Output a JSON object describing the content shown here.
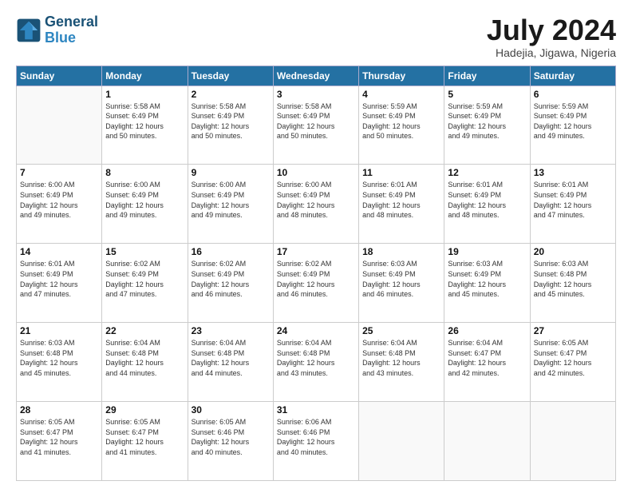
{
  "header": {
    "logo_line1": "General",
    "logo_line2": "Blue",
    "month": "July 2024",
    "location": "Hadejia, Jigawa, Nigeria"
  },
  "days_of_week": [
    "Sunday",
    "Monday",
    "Tuesday",
    "Wednesday",
    "Thursday",
    "Friday",
    "Saturday"
  ],
  "weeks": [
    [
      {
        "day": "",
        "info": ""
      },
      {
        "day": "1",
        "info": "Sunrise: 5:58 AM\nSunset: 6:49 PM\nDaylight: 12 hours\nand 50 minutes."
      },
      {
        "day": "2",
        "info": "Sunrise: 5:58 AM\nSunset: 6:49 PM\nDaylight: 12 hours\nand 50 minutes."
      },
      {
        "day": "3",
        "info": "Sunrise: 5:58 AM\nSunset: 6:49 PM\nDaylight: 12 hours\nand 50 minutes."
      },
      {
        "day": "4",
        "info": "Sunrise: 5:59 AM\nSunset: 6:49 PM\nDaylight: 12 hours\nand 50 minutes."
      },
      {
        "day": "5",
        "info": "Sunrise: 5:59 AM\nSunset: 6:49 PM\nDaylight: 12 hours\nand 49 minutes."
      },
      {
        "day": "6",
        "info": "Sunrise: 5:59 AM\nSunset: 6:49 PM\nDaylight: 12 hours\nand 49 minutes."
      }
    ],
    [
      {
        "day": "7",
        "info": "Sunrise: 6:00 AM\nSunset: 6:49 PM\nDaylight: 12 hours\nand 49 minutes."
      },
      {
        "day": "8",
        "info": "Sunrise: 6:00 AM\nSunset: 6:49 PM\nDaylight: 12 hours\nand 49 minutes."
      },
      {
        "day": "9",
        "info": "Sunrise: 6:00 AM\nSunset: 6:49 PM\nDaylight: 12 hours\nand 49 minutes."
      },
      {
        "day": "10",
        "info": "Sunrise: 6:00 AM\nSunset: 6:49 PM\nDaylight: 12 hours\nand 48 minutes."
      },
      {
        "day": "11",
        "info": "Sunrise: 6:01 AM\nSunset: 6:49 PM\nDaylight: 12 hours\nand 48 minutes."
      },
      {
        "day": "12",
        "info": "Sunrise: 6:01 AM\nSunset: 6:49 PM\nDaylight: 12 hours\nand 48 minutes."
      },
      {
        "day": "13",
        "info": "Sunrise: 6:01 AM\nSunset: 6:49 PM\nDaylight: 12 hours\nand 47 minutes."
      }
    ],
    [
      {
        "day": "14",
        "info": "Sunrise: 6:01 AM\nSunset: 6:49 PM\nDaylight: 12 hours\nand 47 minutes."
      },
      {
        "day": "15",
        "info": "Sunrise: 6:02 AM\nSunset: 6:49 PM\nDaylight: 12 hours\nand 47 minutes."
      },
      {
        "day": "16",
        "info": "Sunrise: 6:02 AM\nSunset: 6:49 PM\nDaylight: 12 hours\nand 46 minutes."
      },
      {
        "day": "17",
        "info": "Sunrise: 6:02 AM\nSunset: 6:49 PM\nDaylight: 12 hours\nand 46 minutes."
      },
      {
        "day": "18",
        "info": "Sunrise: 6:03 AM\nSunset: 6:49 PM\nDaylight: 12 hours\nand 46 minutes."
      },
      {
        "day": "19",
        "info": "Sunrise: 6:03 AM\nSunset: 6:49 PM\nDaylight: 12 hours\nand 45 minutes."
      },
      {
        "day": "20",
        "info": "Sunrise: 6:03 AM\nSunset: 6:48 PM\nDaylight: 12 hours\nand 45 minutes."
      }
    ],
    [
      {
        "day": "21",
        "info": "Sunrise: 6:03 AM\nSunset: 6:48 PM\nDaylight: 12 hours\nand 45 minutes."
      },
      {
        "day": "22",
        "info": "Sunrise: 6:04 AM\nSunset: 6:48 PM\nDaylight: 12 hours\nand 44 minutes."
      },
      {
        "day": "23",
        "info": "Sunrise: 6:04 AM\nSunset: 6:48 PM\nDaylight: 12 hours\nand 44 minutes."
      },
      {
        "day": "24",
        "info": "Sunrise: 6:04 AM\nSunset: 6:48 PM\nDaylight: 12 hours\nand 43 minutes."
      },
      {
        "day": "25",
        "info": "Sunrise: 6:04 AM\nSunset: 6:48 PM\nDaylight: 12 hours\nand 43 minutes."
      },
      {
        "day": "26",
        "info": "Sunrise: 6:04 AM\nSunset: 6:47 PM\nDaylight: 12 hours\nand 42 minutes."
      },
      {
        "day": "27",
        "info": "Sunrise: 6:05 AM\nSunset: 6:47 PM\nDaylight: 12 hours\nand 42 minutes."
      }
    ],
    [
      {
        "day": "28",
        "info": "Sunrise: 6:05 AM\nSunset: 6:47 PM\nDaylight: 12 hours\nand 41 minutes."
      },
      {
        "day": "29",
        "info": "Sunrise: 6:05 AM\nSunset: 6:47 PM\nDaylight: 12 hours\nand 41 minutes."
      },
      {
        "day": "30",
        "info": "Sunrise: 6:05 AM\nSunset: 6:46 PM\nDaylight: 12 hours\nand 40 minutes."
      },
      {
        "day": "31",
        "info": "Sunrise: 6:06 AM\nSunset: 6:46 PM\nDaylight: 12 hours\nand 40 minutes."
      },
      {
        "day": "",
        "info": ""
      },
      {
        "day": "",
        "info": ""
      },
      {
        "day": "",
        "info": ""
      }
    ]
  ]
}
